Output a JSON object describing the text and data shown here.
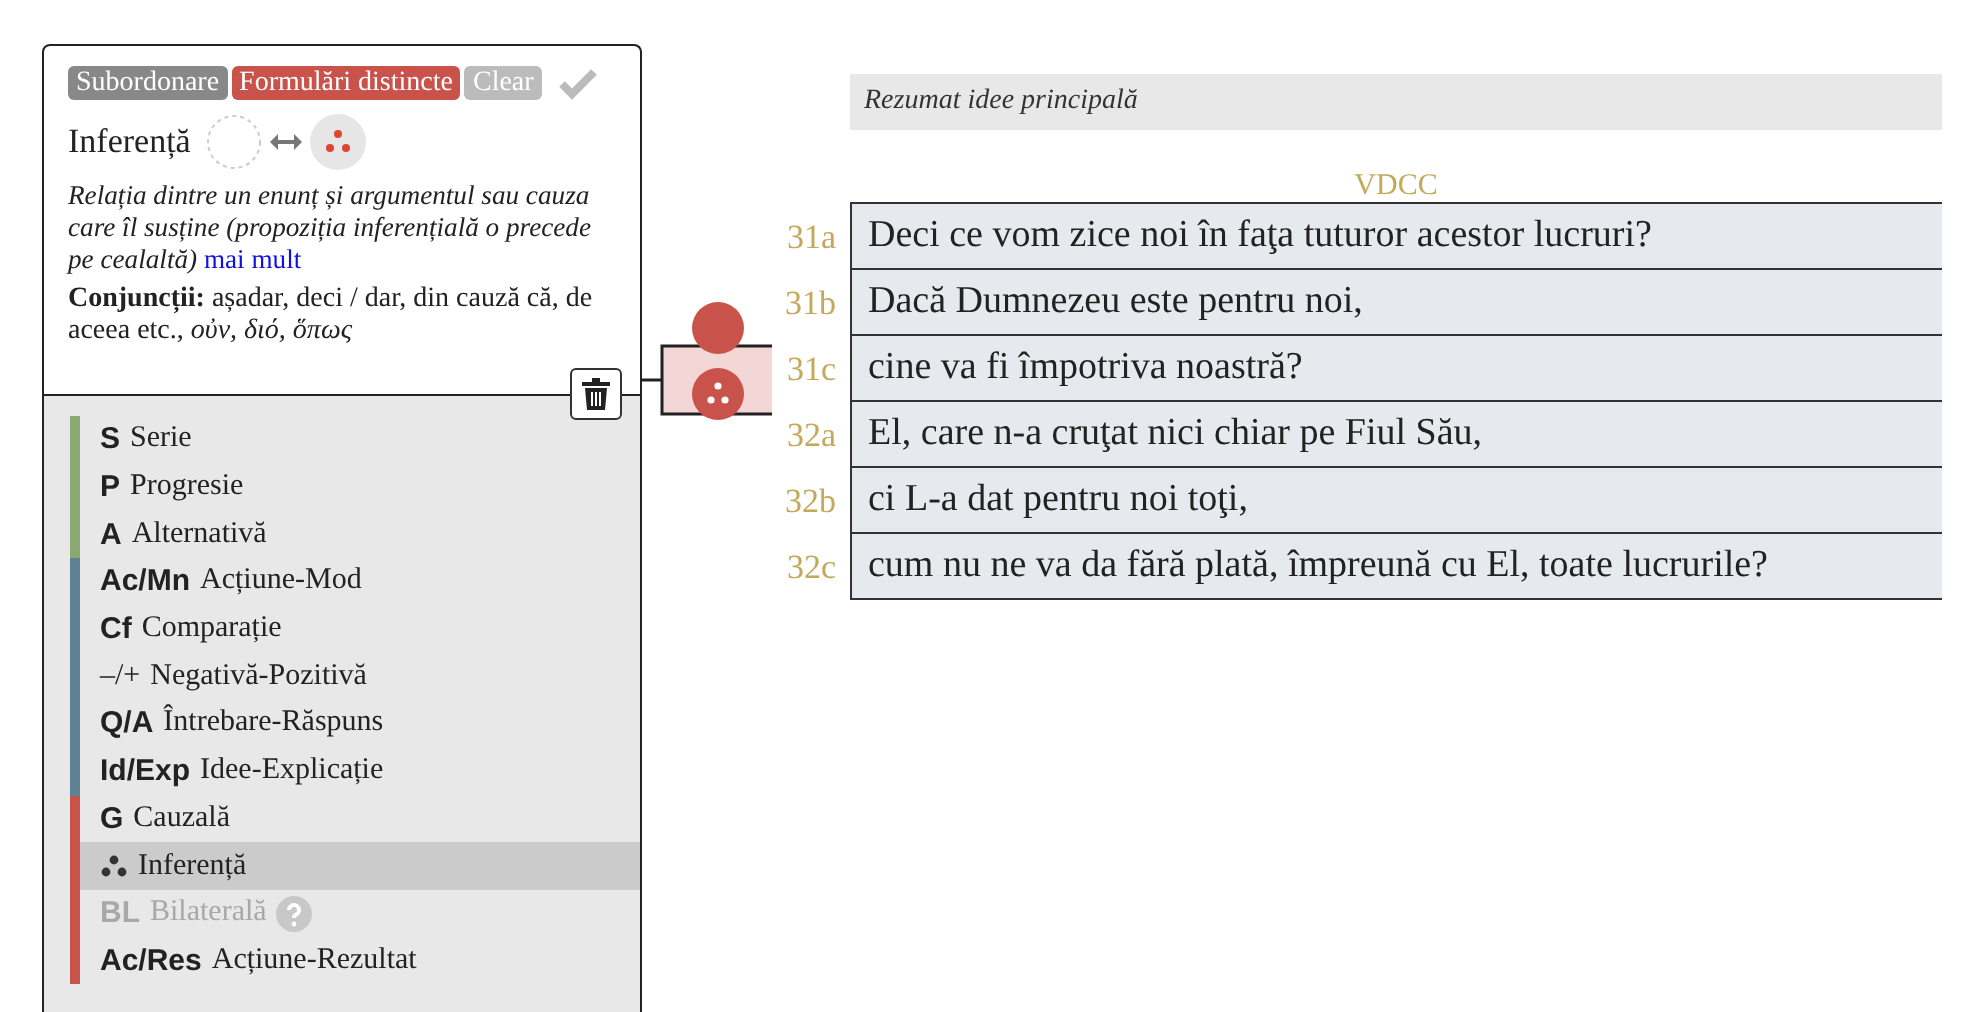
{
  "relation_panel": {
    "tags": [
      {
        "label": "Subordonare",
        "color": "#888888"
      },
      {
        "label": "Formulări distincte",
        "color": "#c9524a"
      },
      {
        "label": "Clear",
        "color": "#bbbbbb"
      }
    ],
    "title": "Inferență",
    "description": "Relația dintre un enunț și argumentul sau cauza care îl susține (propoziția inferențială o precede pe cealaltă)",
    "more_link": "mai mult",
    "conjunctions": "**Conjuncții:** așadar, deci / dar, din cauză că, de aceea etc., *οὐν, διό, ὅπως*"
  },
  "relation_list": [
    {
      "code": "S",
      "label": "Serie",
      "kind": "text",
      "color": "#8aaa72",
      "selected": false,
      "disabled": false
    },
    {
      "code": "P",
      "label": "Progresie",
      "kind": "text",
      "color": "#8aaa72",
      "selected": false,
      "disabled": false
    },
    {
      "code": "A",
      "label": "Alternativă",
      "kind": "text",
      "color": "#8aaa72",
      "selected": false,
      "disabled": false
    },
    {
      "code": "Ac/Mn",
      "label": "Acțiune-Mod",
      "kind": "text",
      "color": "#5f8196",
      "selected": false,
      "disabled": false
    },
    {
      "code": "Cf",
      "label": "Comparație",
      "kind": "text",
      "color": "#5f8196",
      "selected": false,
      "disabled": false
    },
    {
      "code": "–/+",
      "label": "Negativă-Pozitivă",
      "kind": "plain",
      "color": "#5f8196",
      "selected": false,
      "disabled": false
    },
    {
      "code": "Q/A",
      "label": "Întrebare-Răspuns",
      "kind": "text",
      "color": "#5f8196",
      "selected": false,
      "disabled": false
    },
    {
      "code": "Id/Exp",
      "label": "Idee-Explicație",
      "kind": "text",
      "color": "#5f8196",
      "selected": false,
      "disabled": false
    },
    {
      "code": "G",
      "label": "Cauzală",
      "kind": "text",
      "color": "#c9524a",
      "selected": false,
      "disabled": false
    },
    {
      "label": "Inferență",
      "kind": "dots",
      "color": "#c9524a",
      "selected": true,
      "disabled": false
    },
    {
      "code": "BL",
      "label": "Bilaterală",
      "kind": "help",
      "color": "#c9524a",
      "selected": false,
      "disabled": true
    },
    {
      "code": "Ac/Res",
      "label": "Acțiune-Rezultat",
      "kind": "text",
      "color": "#c9524a",
      "selected": false,
      "disabled": false
    }
  ],
  "summary": {
    "placeholder": "Rezumat idee principală"
  },
  "version": "VDCC",
  "verses": [
    {
      "ref": "31a",
      "text": "Deci ce vom zice noi în faţa tuturor acestor lucruri?"
    },
    {
      "ref": "31b",
      "text": "Dacă Dumnezeu este pentru noi,"
    },
    {
      "ref": "31c",
      "text": "cine va fi împotriva noastră?"
    },
    {
      "ref": "32a",
      "text": "El, care n-a cruţat nici chiar pe Fiul Său,"
    },
    {
      "ref": "32b",
      "text": "ci L-a dat pentru noi toţi,"
    },
    {
      "ref": "32c",
      "text": "cum nu ne va da fără plată, împreună cu El, toate lucrurile?"
    }
  ]
}
